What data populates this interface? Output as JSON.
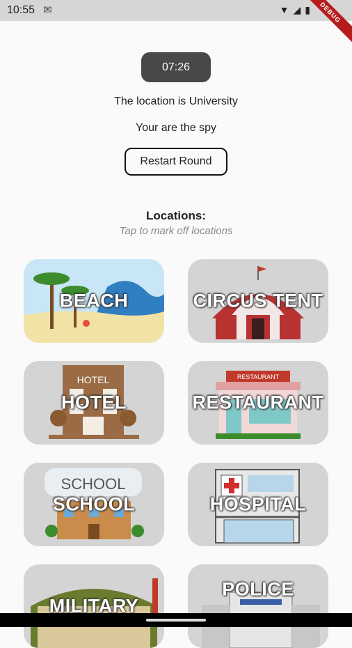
{
  "status_bar": {
    "time": "10:55",
    "mail_icon": "gmail-icon",
    "debug_banner": "DEBUG"
  },
  "timer": "07:26",
  "location_text": "The location is University",
  "role_text": "Your are the spy",
  "restart_label": "Restart Round",
  "locations_title": "Locations:",
  "locations_subtitle": "Tap to mark off locations",
  "locations": [
    {
      "label": "BEACH"
    },
    {
      "label": "CIRCUS TENT"
    },
    {
      "label": "HOTEL"
    },
    {
      "label": "RESTAURANT"
    },
    {
      "label": "SCHOOL"
    },
    {
      "label": "HOSPITAL"
    },
    {
      "label": "MILITARY"
    },
    {
      "label": "POLICE"
    }
  ],
  "art_text": {
    "hotel_sign": "HOTEL",
    "restaurant_sign": "RESTAURANT",
    "school_sign": "SCHOOL"
  }
}
